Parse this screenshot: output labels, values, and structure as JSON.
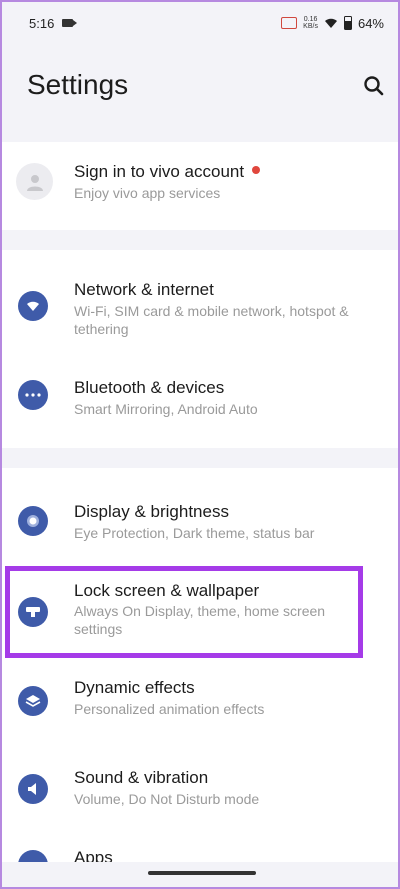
{
  "status_bar": {
    "time": "5:16",
    "net_speed_value": "0.16",
    "net_speed_unit": "KB/s",
    "battery": "64%",
    "icons": [
      "video-camera-icon",
      "cast-icon",
      "wifi-icon",
      "battery-icon"
    ]
  },
  "header": {
    "title": "Settings",
    "search_icon": "search-icon"
  },
  "account": {
    "title": "Sign in to vivo account",
    "subtitle": "Enjoy vivo app services",
    "icon": "person-avatar-icon"
  },
  "group1": [
    {
      "title": "Network & internet",
      "subtitle": "Wi-Fi, SIM card & mobile network, hotspot & tethering",
      "icon": "wifi-icon"
    },
    {
      "title": "Bluetooth & devices",
      "subtitle": "Smart Mirroring, Android Auto",
      "icon": "more-dots-icon"
    }
  ],
  "group2": [
    {
      "title": "Display & brightness",
      "subtitle": "Eye Protection, Dark theme, status bar",
      "icon": "display-icon"
    },
    {
      "title": "Lock screen & wallpaper",
      "subtitle": "Always On Display, theme, home screen settings",
      "icon": "lock-screen-icon"
    },
    {
      "title": "Dynamic effects",
      "subtitle": "Personalized animation effects",
      "icon": "layers-icon"
    },
    {
      "title": "Sound & vibration",
      "subtitle": "Volume, Do Not Disturb mode",
      "icon": "speaker-icon"
    },
    {
      "title": "Apps",
      "subtitle": "",
      "icon": "apps-icon"
    }
  ],
  "colors": {
    "accent_icon": "#3f5ba9",
    "highlight": "#a53be8",
    "background": "#f3f3f8",
    "notification_dot": "#e0473d"
  }
}
